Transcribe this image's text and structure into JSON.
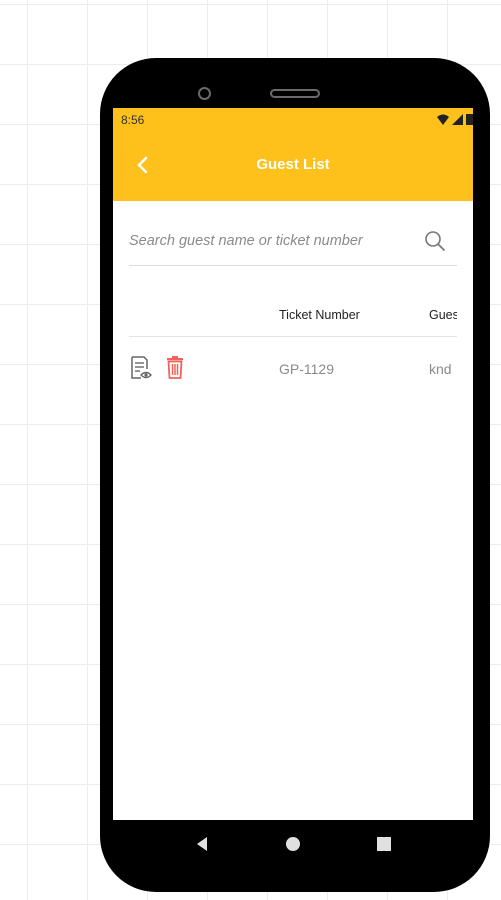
{
  "status_bar": {
    "time": "8:56",
    "icons": [
      "wifi-icon",
      "signal-icon",
      "battery-icon"
    ]
  },
  "app_bar": {
    "title": "Guest List",
    "back_icon": "chevron-left-icon",
    "color": "#fec01a"
  },
  "search": {
    "placeholder": "Search guest name or ticket number",
    "value": "",
    "icon": "search-icon"
  },
  "table": {
    "columns": [
      "",
      "Ticket Number",
      "Gues"
    ],
    "rows": [
      {
        "actions": [
          "view-document-icon",
          "delete-icon"
        ],
        "ticket_number": "GP-1129",
        "guest": "knd"
      }
    ]
  },
  "colors": {
    "accent": "#fec01a",
    "delete": "#f0625a"
  },
  "nav_bar": {
    "buttons": [
      "back-triangle-icon",
      "home-circle-icon",
      "recents-square-icon"
    ]
  }
}
